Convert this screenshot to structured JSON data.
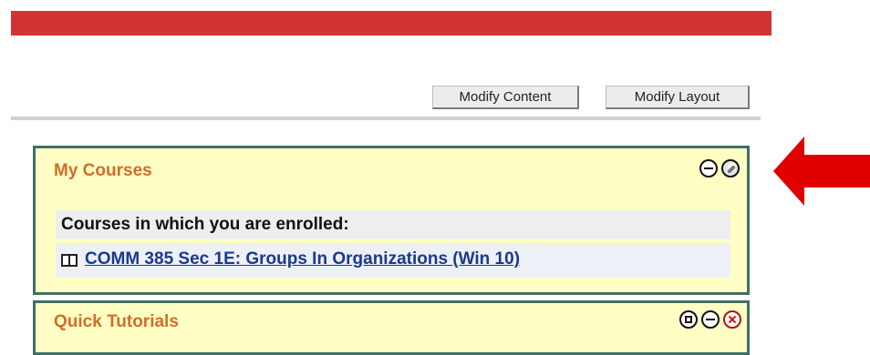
{
  "toolbar": {
    "modify_content_label": "Modify Content",
    "modify_layout_label": "Modify Layout"
  },
  "portlets": {
    "my_courses": {
      "title": "My Courses",
      "enrolled_heading": "Courses in which you are enrolled:",
      "courses": [
        {
          "label": "COMM 385 Sec 1E: Groups In Organizations (Win 10)"
        }
      ],
      "icons": [
        "minimize-icon",
        "edit-icon"
      ]
    },
    "quick_tutorials": {
      "title": "Quick Tutorials",
      "icons": [
        "restore-icon",
        "minimize-icon",
        "close-icon"
      ]
    }
  },
  "colors": {
    "header_bar": "#d03434",
    "portlet_bg": "#ffffc4",
    "portlet_border": "#3f6f65",
    "portlet_title": "#d16d2a",
    "link": "#1a3a8a",
    "annotation_arrow": "#e00000"
  }
}
